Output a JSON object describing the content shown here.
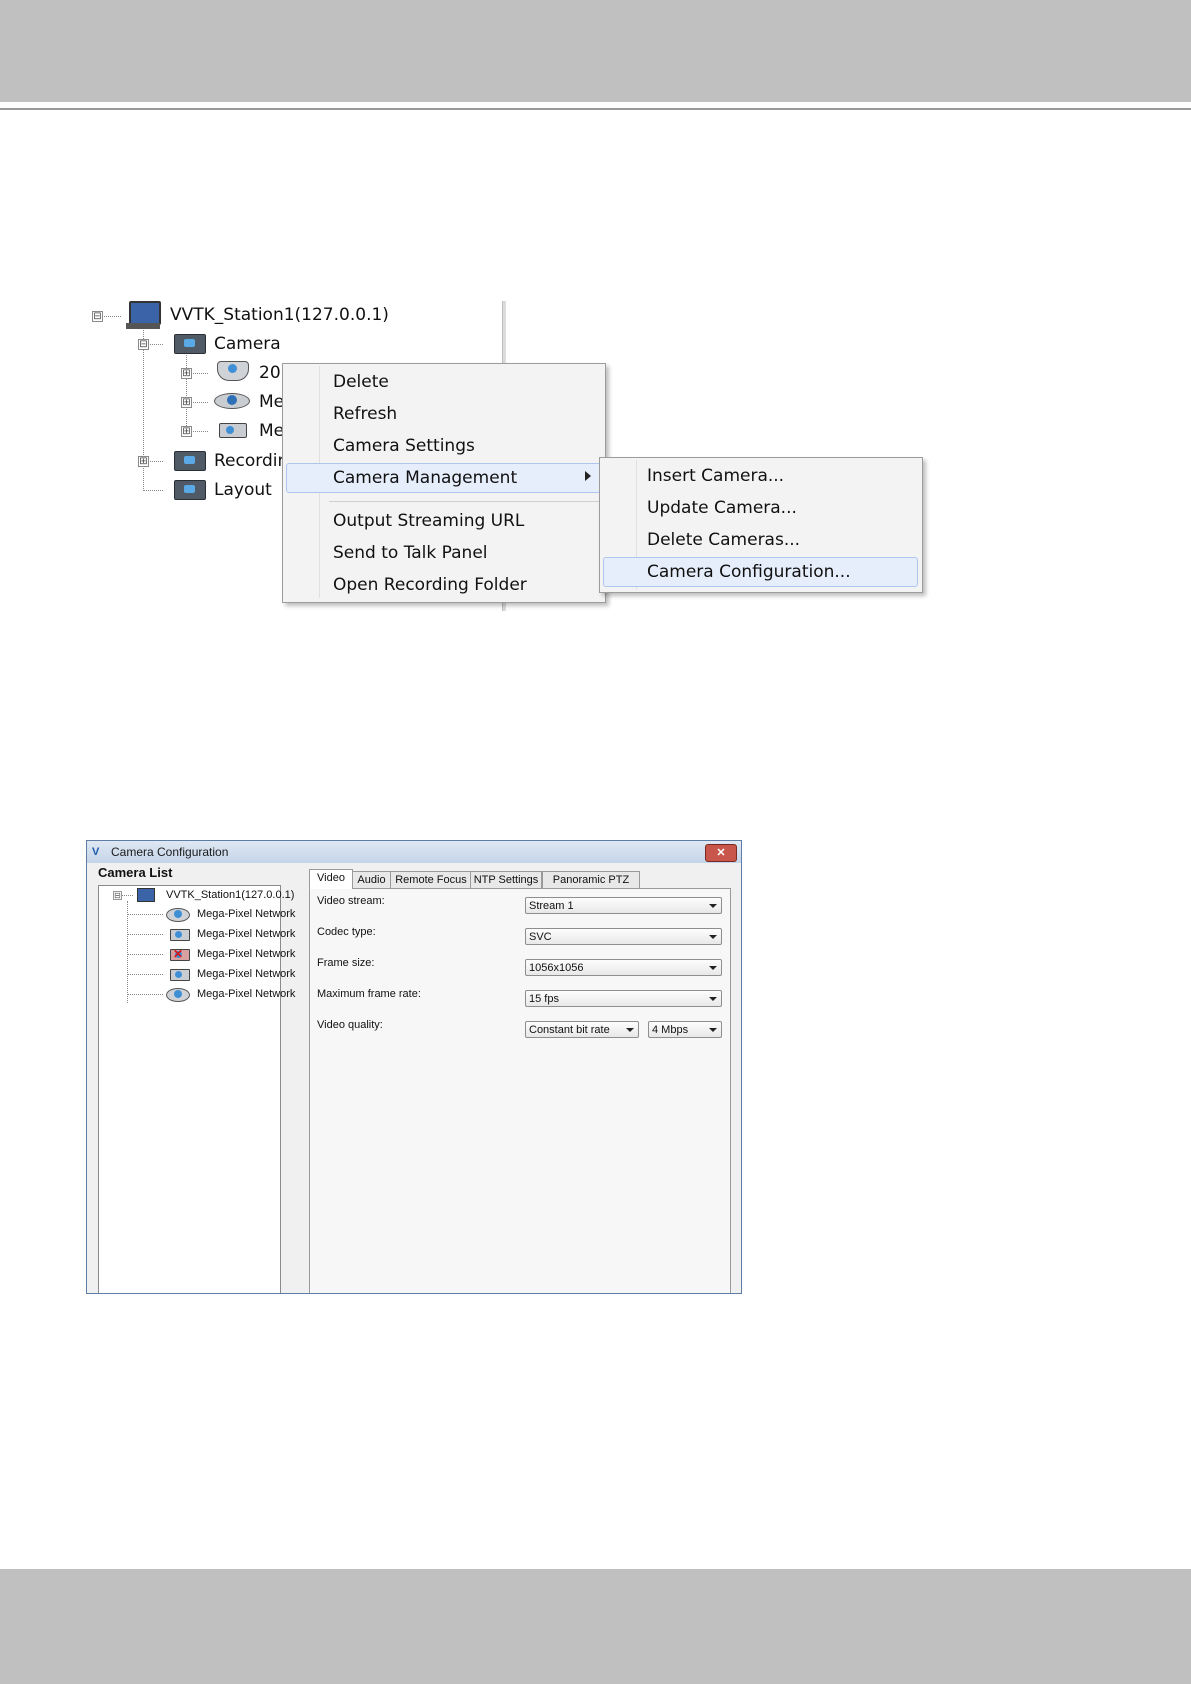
{
  "tree": {
    "station": "VVTK_Station1(127.0.0.1)",
    "camera_folder": "Camera",
    "cameras": [
      "20",
      "Me",
      "Me"
    ],
    "recording": "Recordin",
    "layout": "Layout"
  },
  "context_menu": {
    "items": [
      "Delete",
      "Refresh",
      "Camera Settings",
      "Camera Management",
      "Output Streaming URL",
      "Send to Talk Panel",
      "Open Recording Folder"
    ],
    "highlighted": "Camera Management"
  },
  "submenu": {
    "items": [
      "Insert Camera...",
      "Update Camera...",
      "Delete Cameras...",
      "Camera Configuration..."
    ],
    "highlighted": "Camera Configuration..."
  },
  "config_window": {
    "title": "Camera Configuration",
    "close_symbol": "✕",
    "camera_list_title": "Camera List",
    "station": "VVTK_Station1(127.0.0.1)",
    "cameras": [
      "Mega-Pixel Network",
      "Mega-Pixel Network",
      "Mega-Pixel Network",
      "Mega-Pixel Network",
      "Mega-Pixel Network"
    ],
    "tabs": [
      "Video",
      "Audio",
      "Remote Focus",
      "NTP Settings",
      "Panoramic PTZ"
    ],
    "active_tab": "Video",
    "fields": {
      "video_stream": {
        "label": "Video stream:",
        "value": "Stream 1"
      },
      "codec_type": {
        "label": "Codec type:",
        "value": "SVC"
      },
      "frame_size": {
        "label": "Frame size:",
        "value": "1056x1056"
      },
      "max_frame_rate": {
        "label": "Maximum frame rate:",
        "value": "15 fps"
      },
      "video_quality": {
        "label": "Video quality:",
        "value": "Constant bit rate",
        "bitrate": "4 Mbps"
      }
    }
  },
  "icons": {
    "expand": "⊞",
    "collapse": "⊟"
  },
  "colors": {
    "header_band": "#c0c0c0",
    "menu_highlight": "#e6eefb",
    "title_bar": "#c4d4e8"
  }
}
